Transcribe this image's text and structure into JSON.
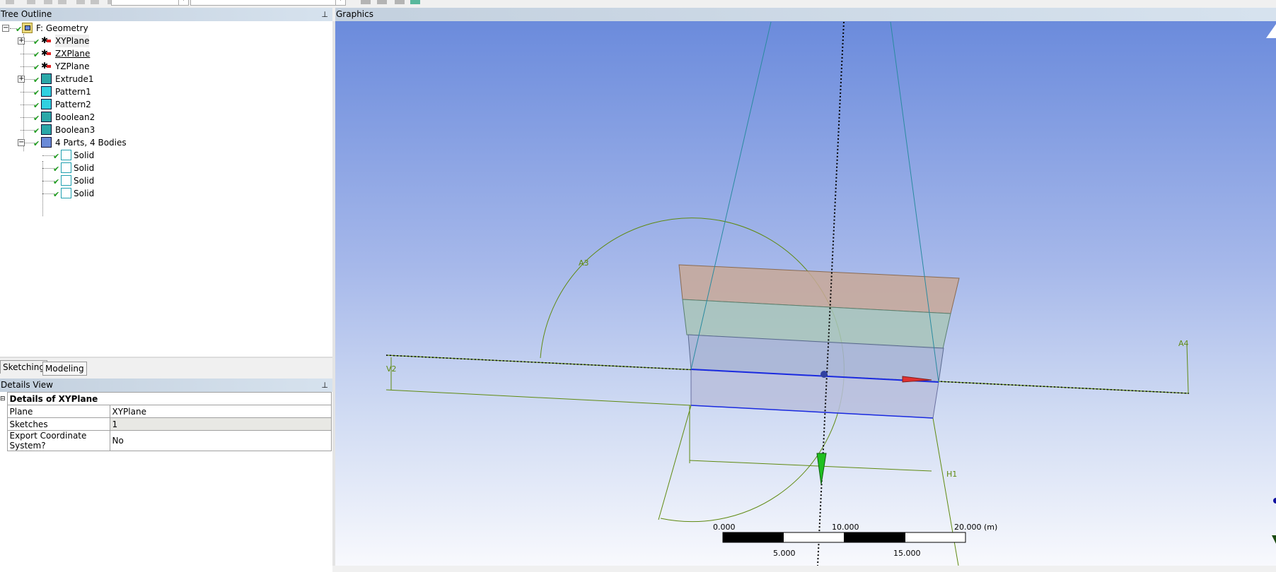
{
  "tree_outline": {
    "title": "Tree Outline",
    "items": [
      {
        "label": "F: Geometry",
        "icon": "geometry-folder-icon"
      },
      {
        "label": "XYPlane",
        "icon": "plane-axes-icon"
      },
      {
        "label": "ZXPlane",
        "icon": "plane-axes-icon"
      },
      {
        "label": "YZPlane",
        "icon": "plane-axes-icon"
      },
      {
        "label": "Extrude1",
        "icon": "extrude-icon"
      },
      {
        "label": "Pattern1",
        "icon": "pattern-icon"
      },
      {
        "label": "Pattern2",
        "icon": "pattern-icon"
      },
      {
        "label": "Boolean2",
        "icon": "boolean-icon"
      },
      {
        "label": "Boolean3",
        "icon": "boolean-icon"
      },
      {
        "label": "4 Parts, 4 Bodies",
        "icon": "parts-icon"
      },
      {
        "label": "Solid",
        "icon": "solid-body-icon"
      },
      {
        "label": "Solid",
        "icon": "solid-body-icon"
      },
      {
        "label": "Solid",
        "icon": "solid-body-icon"
      },
      {
        "label": "Solid",
        "icon": "solid-body-icon"
      }
    ]
  },
  "tabs": {
    "sketching": "Sketching",
    "modeling": "Modeling"
  },
  "details": {
    "title": "Details View",
    "section": "Details of XYPlane",
    "rows": [
      {
        "name": "Plane",
        "value": "XYPlane"
      },
      {
        "name": "Sketches",
        "value": "1"
      },
      {
        "name": "Export Coordinate System?",
        "value": "No"
      }
    ]
  },
  "graphics": {
    "title": "Graphics",
    "dimensions": {
      "a3": "A3",
      "a4": "A4",
      "v2": "V2",
      "h1": "H1"
    },
    "scale_bar": {
      "top": [
        "0.000",
        "10.000",
        "20.000 (m)"
      ],
      "bottom": [
        "5.000",
        "15.000"
      ]
    }
  },
  "colors": {
    "bg_top": "#6b8bdc",
    "bg_bottom": "#f8f9fd",
    "dim": "#5f8a10",
    "check": "#1a9a1a"
  }
}
